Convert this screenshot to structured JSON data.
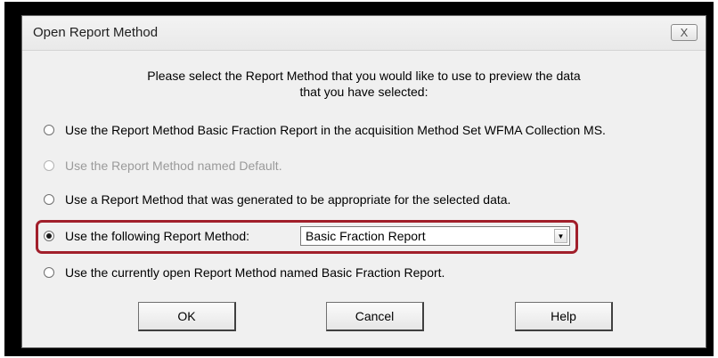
{
  "dialog": {
    "title": "Open Report Method",
    "close_label": "X"
  },
  "instruction": {
    "line1": "Please select the Report Method that you would like to use to preview the data",
    "line2": "that you have selected:"
  },
  "options": [
    {
      "label": "Use the Report Method Basic Fraction Report in the acquisition Method Set WFMA Collection MS.",
      "selected": false,
      "enabled": true
    },
    {
      "label": "Use the Report Method named Default.",
      "selected": false,
      "enabled": false
    },
    {
      "label": "Use a Report Method that was generated to be appropriate for the selected data.",
      "selected": false,
      "enabled": true
    },
    {
      "label": "Use the following Report Method:",
      "selected": true,
      "enabled": true
    },
    {
      "label": "Use the currently open Report Method named Basic Fraction Report.",
      "selected": false,
      "enabled": true
    }
  ],
  "report_method_select": {
    "value": "Basic Fraction Report",
    "arrow": "▼"
  },
  "buttons": {
    "ok": "OK",
    "cancel": "Cancel",
    "help": "Help"
  },
  "colors": {
    "highlight": "#a11f2b",
    "dialog_background": "#f0f0f0"
  },
  "icons": {
    "close": "close-icon",
    "dropdown": "chevron-down-icon"
  }
}
